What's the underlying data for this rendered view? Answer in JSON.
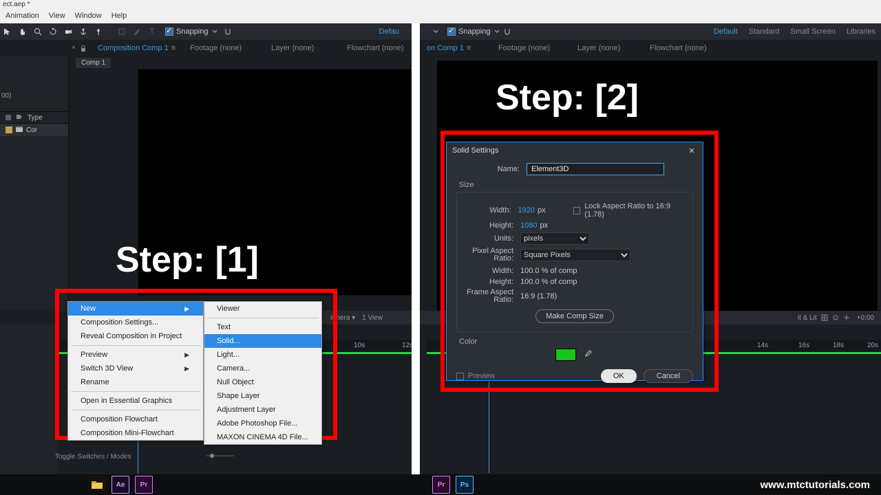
{
  "title_fragment": "ect.aep *",
  "menu": {
    "animation": "Animation",
    "view": "View",
    "window": "Window",
    "help": "Help"
  },
  "toolbar": {
    "snapping": "Snapping"
  },
  "workspace": {
    "default": "Default",
    "standard": "Standard",
    "small": "Small Screen",
    "libraries": "Libraries",
    "defau_cut": "Defau"
  },
  "tabs": {
    "comp_prefix": "Composition",
    "comp_name": "Comp 1",
    "footage": "Footage  (none)",
    "layer": "Layer  (none)",
    "flowchart": "Flowchart  (none)",
    "on_comp": "on Comp 1"
  },
  "project_panel": {
    "type_hdr": "Type",
    "row_name": "Cor"
  },
  "viewer_ctrl": {
    "active": "Active Camera",
    "view1": "1 View",
    "lit": "it & Lit",
    "zero": "+0:00"
  },
  "step1": "Step: [1]",
  "step2": "Step: [2]",
  "ctx_main": {
    "new": "New",
    "comp_settings": "Composition Settings...",
    "reveal": "Reveal Composition in Project",
    "preview": "Preview",
    "switch3d": "Switch 3D View",
    "rename": "Rename",
    "essential": "Open in Essential Graphics",
    "flowchart": "Composition Flowchart",
    "mini": "Composition Mini-Flowchart"
  },
  "ctx_sub": {
    "viewer": "Viewer",
    "text": "Text",
    "solid": "Solid...",
    "light": "Light...",
    "camera": "Camera...",
    "null": "Null Object",
    "shape": "Shape Layer",
    "adjust": "Adjustment Layer",
    "ps": "Adobe Photoshop File...",
    "c4d": "MAXON CINEMA 4D File..."
  },
  "dialog": {
    "title": "Solid Settings",
    "name_lbl": "Name:",
    "name_val": "Element3D",
    "size": "Size",
    "width_lbl": "Width:",
    "width_val": "1920",
    "px": "px",
    "height_lbl": "Height:",
    "height_val": "1080",
    "lock": "Lock Aspect Ratio to 16:9 (1.78)",
    "units_lbl": "Units:",
    "units_val": "pixels",
    "par_lbl": "Pixel Aspect Ratio:",
    "par_val": "Square Pixels",
    "w100": "100.0 % of comp",
    "h100": "100.0 % of comp",
    "far_lbl": "Frame Aspect Ratio:",
    "far_val": "16:9 (1.78)",
    "make_comp": "Make Comp Size",
    "color": "Color",
    "preview": "Preview",
    "ok": "OK",
    "cancel": "Cancel",
    "width_label2": "Width:",
    "height_label2": "Height:"
  },
  "timeline": {
    "toggle": "Toggle Switches / Modes",
    "ticks_left": [
      "10s",
      "12s"
    ],
    "ticks_right": [
      "14s",
      "16s",
      "18s",
      "20s"
    ],
    "zero": "00)"
  },
  "watermark": "www.mtctutorials.com"
}
